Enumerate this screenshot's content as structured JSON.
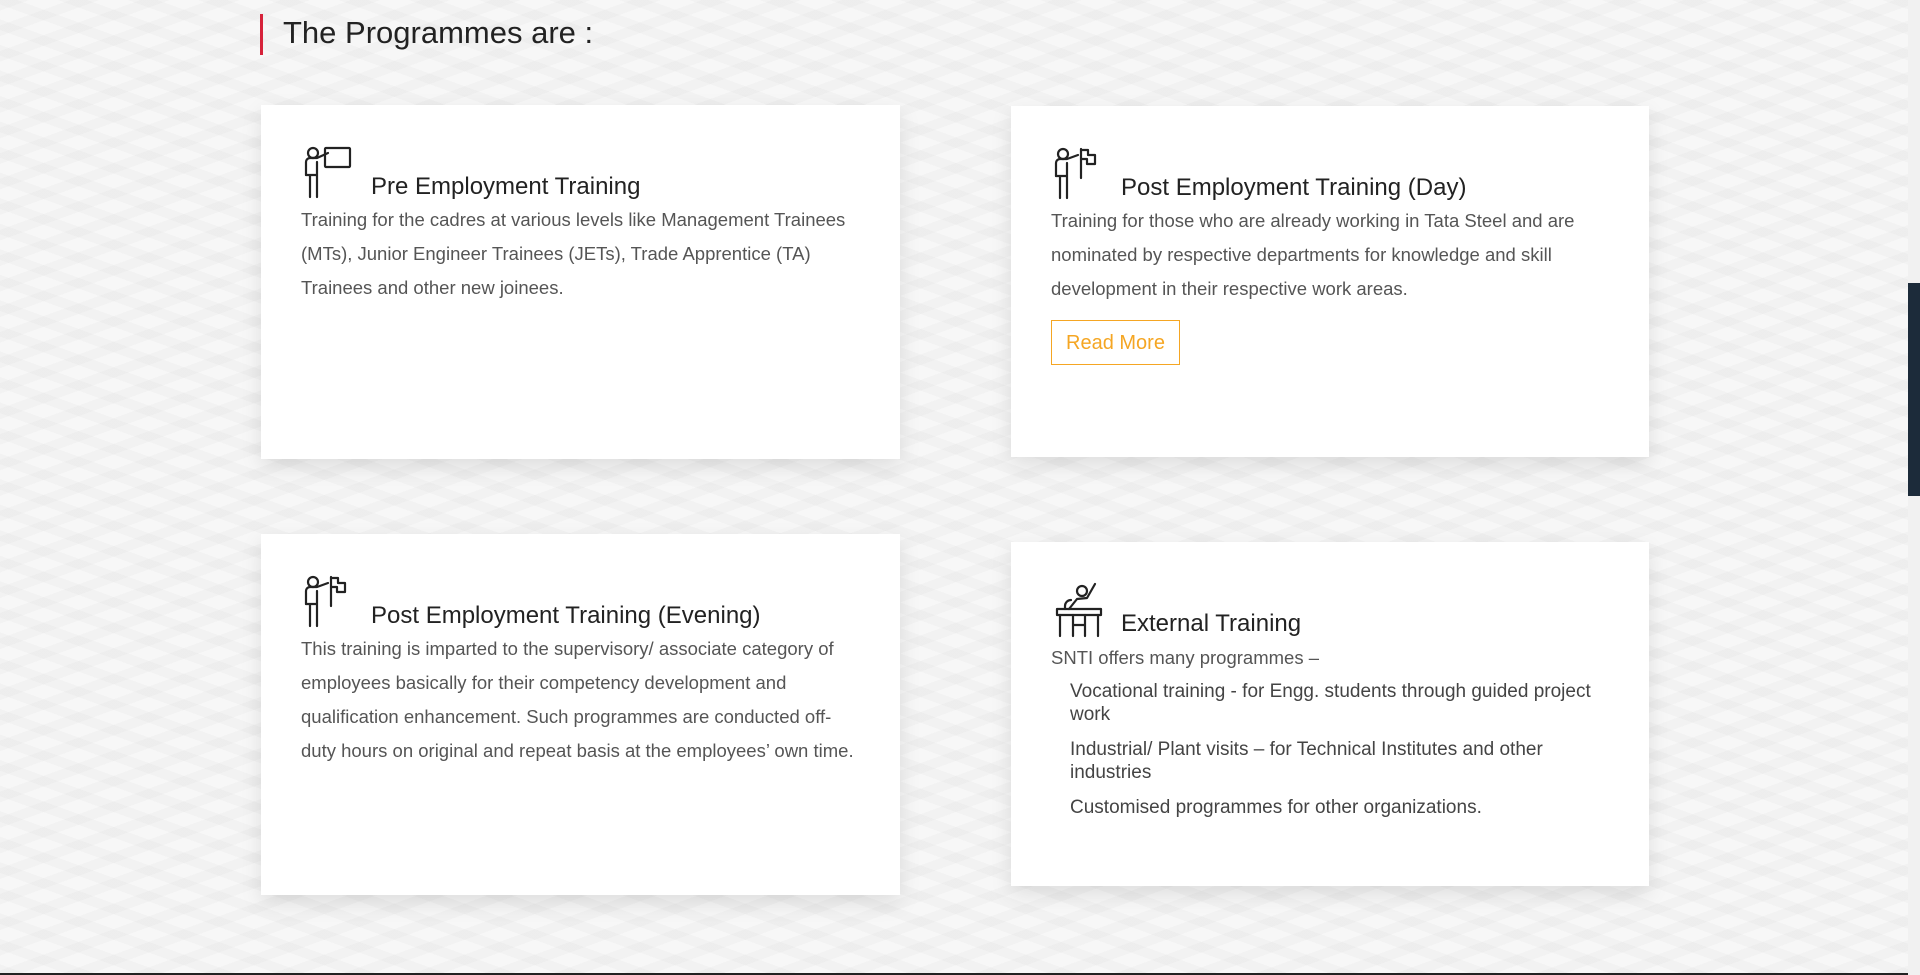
{
  "section": {
    "heading": "The Programmes are :"
  },
  "cards": [
    {
      "title": "Pre Employment Training",
      "icon": "trainer-board-icon",
      "description": "Training for the cadres at various levels like Management Trainees (MTs), Junior Engineer Trainees (JETs), Trade Apprentice (TA) Trainees and other new joinees."
    },
    {
      "title": "Post Employment Training (Day)",
      "icon": "trainer-flag-icon",
      "description": "Training for those who are already working in Tata Steel and are nominated by respective departments for knowledge and skill development in their respective work areas.",
      "button_label": "Read More"
    },
    {
      "title": "Post Employment Training (Evening)",
      "icon": "trainer-flag-icon",
      "description": "This training is imparted to the supervisory/ associate category of employees basically for their competency development and qualification enhancement. Such programmes are conducted off-duty hours on original and repeat basis at the employees’ own time."
    },
    {
      "title": "External Training",
      "icon": "student-desk-icon",
      "intro": "SNTI offers many programmes –",
      "items": [
        "Vocational training - for Engg. students through guided project work",
        "Industrial/ Plant visits – for Technical Institutes and other industries",
        "Customised programmes for other organizations."
      ]
    }
  ],
  "colors": {
    "accent_red": "#d6223a",
    "button_orange": "#f5a623",
    "scroll_thumb": "#1c2b3a"
  }
}
